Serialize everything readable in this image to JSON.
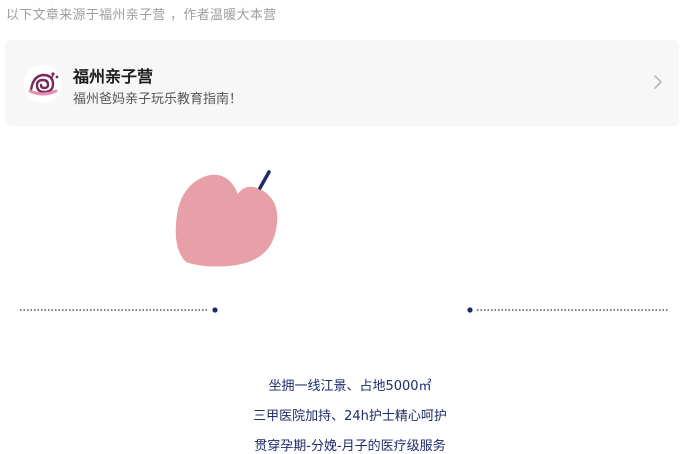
{
  "source_note": "以下文章来源于福州亲子营 ，作者温暖大本营",
  "account": {
    "name": "福州亲子营",
    "description": "福州爸妈亲子玩乐教育指南！"
  },
  "colors": {
    "accent_navy": "#1f2a6b",
    "heart_pink": "#e8a0a8"
  },
  "icons": {
    "avatar": "snail-logo-icon",
    "chevron": "chevron-right-icon",
    "decor": "pink-heart-icon"
  },
  "taglines": [
    "坐拥一线江景、占地5000㎡",
    "三甲医院加持、24h护士精心呵护",
    "贯穿孕期-分娩-月子的医疗级服务"
  ]
}
